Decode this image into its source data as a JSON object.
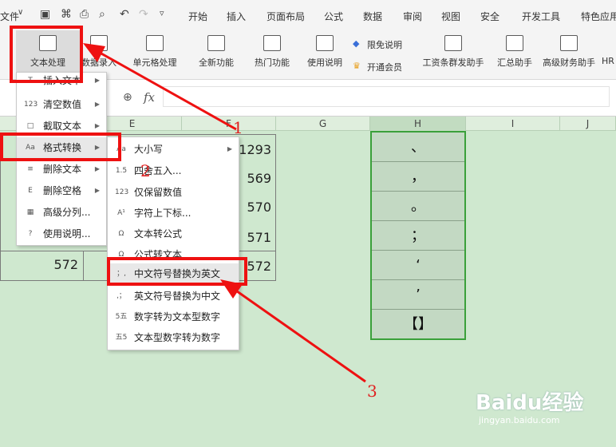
{
  "topbar": {
    "file_label": "文件",
    "menus": [
      "开始",
      "插入",
      "页面布局",
      "公式",
      "数据",
      "审阅",
      "视图",
      "安全",
      "开发工具",
      "特色应用"
    ]
  },
  "ribbon": {
    "buttons": [
      {
        "label": "文本处理"
      },
      {
        "label": "数据录入"
      },
      {
        "label": "单元格处理"
      },
      {
        "label": "全新功能"
      },
      {
        "label": "热门功能"
      },
      {
        "label": "使用说明"
      }
    ],
    "free_label": "限免说明",
    "vip_label": "开通会员",
    "right_buttons": [
      {
        "label": "工资条群发助手"
      },
      {
        "label": "汇总助手"
      },
      {
        "label": "高级财务助手"
      },
      {
        "label": "HR"
      }
    ]
  },
  "formula": {
    "fx": "fx"
  },
  "columns": [
    "E",
    "F",
    "G",
    "H",
    "I",
    "J"
  ],
  "cells": {
    "f_values": [
      "1293",
      "569",
      "570",
      "571",
      "572"
    ],
    "a_value": "572"
  },
  "h_column": [
    "、",
    "，",
    "。",
    "；",
    "‘",
    "’",
    "【】"
  ],
  "menu1": {
    "items": [
      {
        "label": "插入文本",
        "icon": "T"
      },
      {
        "label": "清空数值",
        "icon": "123"
      },
      {
        "label": "截取文本",
        "icon": "□"
      },
      {
        "label": "格式转换",
        "icon": "Aa"
      },
      {
        "label": "删除文本",
        "icon": "≡"
      },
      {
        "label": "删除空格",
        "icon": "E"
      },
      {
        "label": "高级分列...",
        "icon": "▦"
      },
      {
        "label": "使用说明...",
        "icon": "?"
      }
    ]
  },
  "menu2": {
    "items": [
      {
        "label": "大小写",
        "icon": "Aa"
      },
      {
        "label": "四舍五入...",
        "icon": "1.5"
      },
      {
        "label": "仅保留数值",
        "icon": "123"
      },
      {
        "label": "字符上下标...",
        "icon": "A¹"
      },
      {
        "label": "文本转公式",
        "icon": "Ω"
      },
      {
        "label": "公式转文本",
        "icon": "Ω"
      },
      {
        "label": "中文符号替换为英文",
        "icon": "；,"
      },
      {
        "label": "英文符号替换为中文",
        "icon": ",；"
      },
      {
        "label": "数字转为文本型数字",
        "icon": "5五"
      },
      {
        "label": "文本型数字转为数字",
        "icon": "五5"
      }
    ]
  },
  "annotations": [
    "1",
    "2",
    "3"
  ],
  "watermark": {
    "brand": "Baidu经验",
    "url": "jingyan.baidu.com"
  },
  "colors": {
    "accent": "#ee1111",
    "sheet_bg": "#cfe8cf",
    "selection": "#3aa03a"
  }
}
